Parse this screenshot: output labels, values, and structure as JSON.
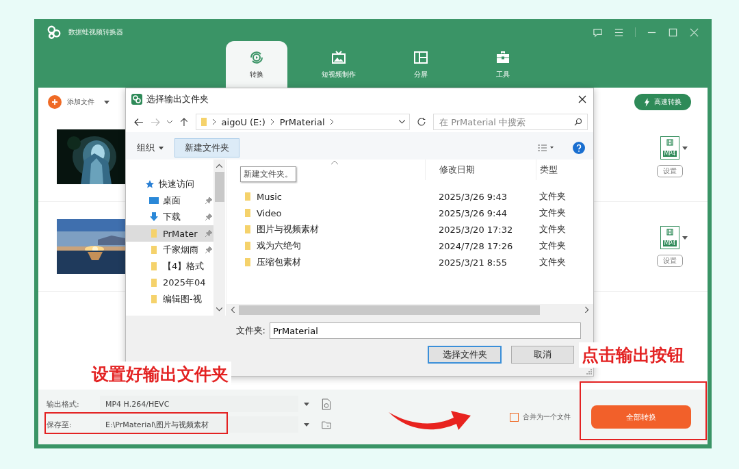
{
  "app": {
    "title": "数据蛙视频转换器",
    "tabs": [
      {
        "label": "转换",
        "kind": "convert",
        "selected": true
      },
      {
        "label": "短视频制作",
        "kind": "tv",
        "selected": false
      },
      {
        "label": "分屏",
        "kind": "split",
        "selected": false
      },
      {
        "label": "工具",
        "kind": "toolbox",
        "selected": false
      }
    ]
  },
  "toolbar": {
    "add_file": "添加文件",
    "fast_convert": "高速转换"
  },
  "videos": [
    {
      "kind": "picture",
      "format": "MP4",
      "settings": "设置"
    },
    {
      "kind": "picture",
      "format": "MP4",
      "settings": "设置"
    }
  ],
  "bottom": {
    "format_label": "输出格式:",
    "format_value": "MP4 H.264/HEVC",
    "save_label": "保存至:",
    "save_value": "E:\\PrMaterial\\图片与视频素材",
    "merge": {
      "label": "合并为一个文件",
      "checked": false
    },
    "convert_all": "全部转换"
  },
  "dialog": {
    "title": "选择输出文件夹",
    "breadcrumb": [
      "aigoU (E:)",
      "PrMaterial"
    ],
    "search_placeholder": "在 PrMaterial 中搜索",
    "organize": "组织",
    "new_folder": "新建文件夹",
    "tooltip": "新建文件夹。",
    "nav": [
      {
        "label": "快速访问",
        "kind": "star",
        "selected": false,
        "children": [
          {
            "label": "桌面",
            "kind": "desktop",
            "pinned": true,
            "selected": false
          },
          {
            "label": "下载",
            "kind": "download",
            "pinned": true,
            "selected": false
          },
          {
            "label": "PrMater",
            "kind": "folder",
            "pinned": true,
            "selected": true
          },
          {
            "label": "千家烟雨",
            "kind": "folder",
            "pinned": true,
            "selected": false
          },
          {
            "label": "【4】格式",
            "kind": "folder",
            "pinned": false,
            "selected": false
          },
          {
            "label": "2025年04",
            "kind": "folder",
            "pinned": false,
            "selected": false
          },
          {
            "label": "编辑图-视",
            "kind": "folder",
            "pinned": false,
            "selected": false
          }
        ]
      }
    ],
    "columns": [
      "修改日期",
      "类型"
    ],
    "files": [
      {
        "name": "Music",
        "date": "2025/3/26 9:43",
        "type": "文件夹"
      },
      {
        "name": "Video",
        "date": "2025/3/26 9:44",
        "type": "文件夹"
      },
      {
        "name": "图片与视频素材",
        "date": "2025/3/20 17:32",
        "type": "文件夹"
      },
      {
        "name": "戏为六绝句",
        "date": "2024/7/28 17:26",
        "type": "文件夹"
      },
      {
        "name": "压缩包素材",
        "date": "2025/3/21 8:55",
        "type": "文件夹"
      }
    ],
    "folder_label": "文件夹:",
    "folder_value": "PrMaterial",
    "buttons": [
      {
        "label": "选择文件夹",
        "kind": "primary"
      },
      {
        "label": "取消",
        "kind": "secondary"
      }
    ]
  },
  "annotations": [
    {
      "text": "设置好输出文件夹"
    },
    {
      "text": "点击输出按钮"
    }
  ]
}
